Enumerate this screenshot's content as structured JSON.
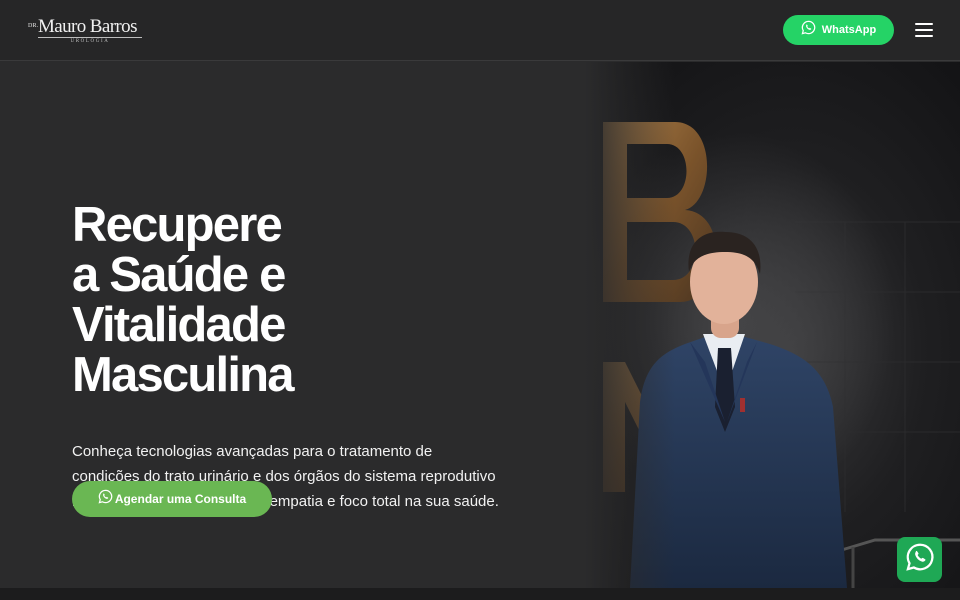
{
  "header": {
    "logo": {
      "prefix": "DR.",
      "name": "Mauro Barros",
      "subtitle": "UROLOGIA"
    },
    "whatsapp_label": "WhatsApp",
    "whatsapp_icon": "whatsapp-icon",
    "menu_icon": "hamburger-menu-icon"
  },
  "hero": {
    "headline_lines": [
      "Recupere",
      "a Saúde e",
      "Vitalidade",
      "Masculina"
    ],
    "lead_lines": [
      "Conheça tecnologias avançadas para o tratamento de",
      "condições do trato urinário e dos órgãos do sistema reprodutivo",
      "masculino, com acolhimento, empatia e foco total na sua saúde."
    ],
    "cta_label": "Agendar uma Consulta",
    "cta_icon": "whatsapp-icon",
    "photo_wall_letters": [
      "B",
      "M"
    ]
  },
  "floating_whatsapp_icon": "whatsapp-icon",
  "colors": {
    "background": "#2b2b2c",
    "header_whatsapp_button": "#25d366",
    "cta_button": "#6ab753",
    "floating_button": "#1fa855",
    "wall_letter_bronze": "#9b6b34"
  }
}
